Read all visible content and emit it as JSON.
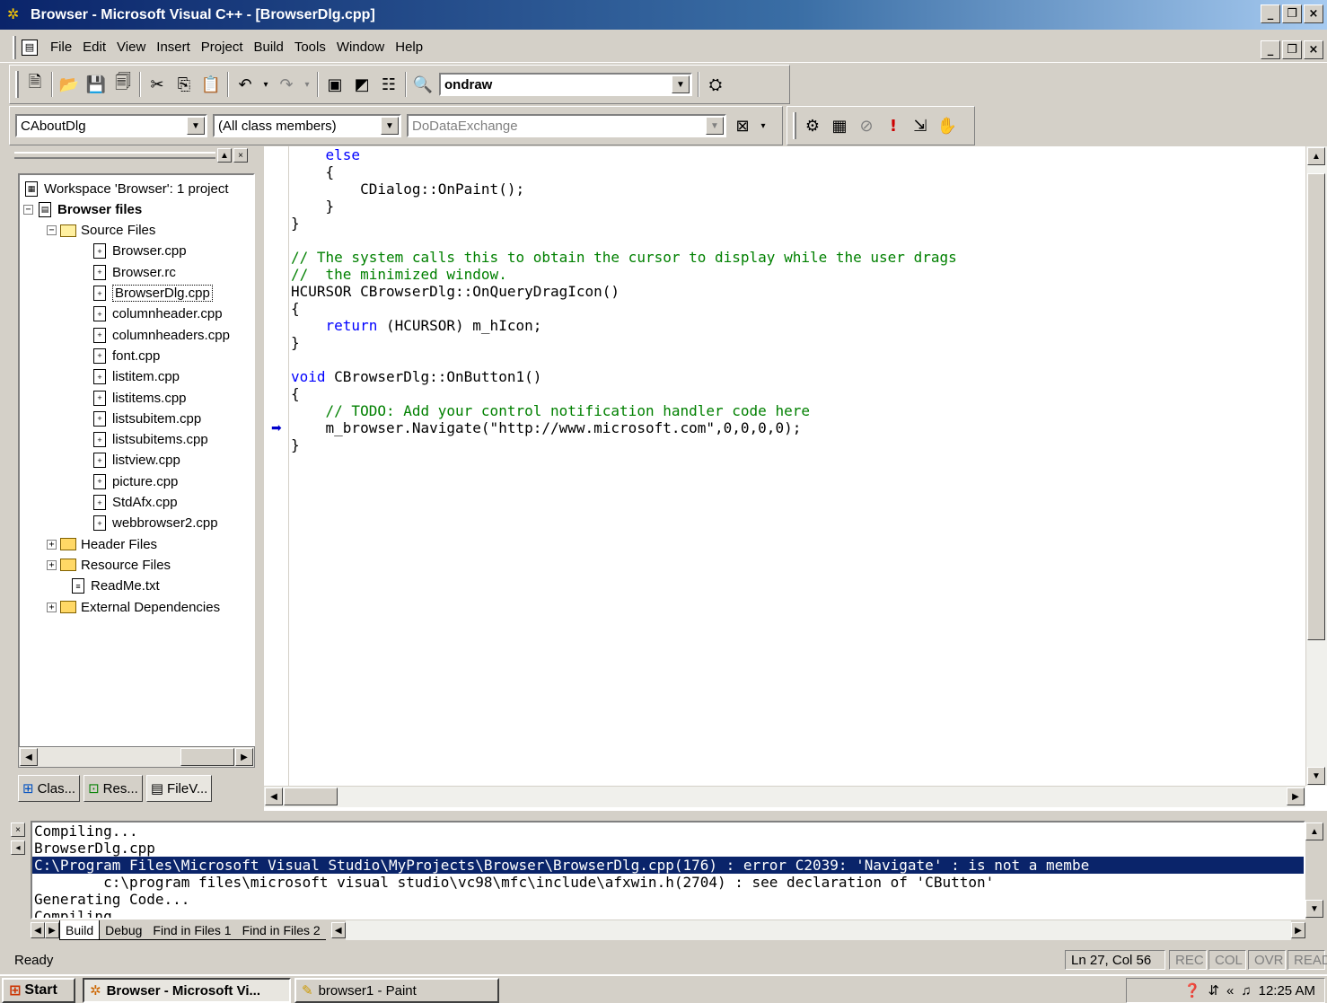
{
  "window": {
    "title": "Browser - Microsoft Visual C++ - [BrowserDlg.cpp]",
    "min": "_",
    "restore": "❐",
    "close": "×"
  },
  "menu": {
    "items": [
      "File",
      "Edit",
      "View",
      "Insert",
      "Project",
      "Build",
      "Tools",
      "Window",
      "Help"
    ]
  },
  "toolbar": {
    "find_combo_value": "ondraw"
  },
  "wizardbar": {
    "class_combo": "CAboutDlg",
    "filter_combo": "(All class members)",
    "member_combo": "DoDataExchange"
  },
  "workspace": {
    "root": "Workspace 'Browser': 1 project",
    "project": "Browser files",
    "source_folder": "Source Files",
    "source_files": [
      "Browser.cpp",
      "Browser.rc",
      "BrowserDlg.cpp",
      "columnheader.cpp",
      "columnheaders.cpp",
      "font.cpp",
      "listitem.cpp",
      "listitems.cpp",
      "listsubitem.cpp",
      "listsubitems.cpp",
      "listview.cpp",
      "picture.cpp",
      "StdAfx.cpp",
      "webbrowser2.cpp"
    ],
    "header_folder": "Header Files",
    "resource_folder": "Resource Files",
    "readme": "ReadMe.txt",
    "external": "External Dependencies",
    "tabs": [
      "Clas...",
      "Res...",
      "FileV..."
    ]
  },
  "editor": {
    "lines": [
      {
        "indent": "    ",
        "parts": [
          {
            "t": "kw",
            "s": "else"
          }
        ]
      },
      {
        "indent": "    ",
        "parts": [
          {
            "t": "",
            "s": "{"
          }
        ]
      },
      {
        "indent": "        ",
        "parts": [
          {
            "t": "",
            "s": "CDialog::OnPaint();"
          }
        ]
      },
      {
        "indent": "    ",
        "parts": [
          {
            "t": "",
            "s": "}"
          }
        ]
      },
      {
        "indent": "",
        "parts": [
          {
            "t": "",
            "s": "}"
          }
        ]
      },
      {
        "indent": "",
        "parts": [
          {
            "t": "",
            "s": ""
          }
        ]
      },
      {
        "indent": "",
        "parts": [
          {
            "t": "cm",
            "s": "// The system calls this to obtain the cursor to display while the user drags"
          }
        ]
      },
      {
        "indent": "",
        "parts": [
          {
            "t": "cm",
            "s": "//  the minimized window."
          }
        ]
      },
      {
        "indent": "",
        "parts": [
          {
            "t": "",
            "s": "HCURSOR CBrowserDlg::OnQueryDragIcon()"
          }
        ]
      },
      {
        "indent": "",
        "parts": [
          {
            "t": "",
            "s": "{"
          }
        ]
      },
      {
        "indent": "    ",
        "parts": [
          {
            "t": "kw",
            "s": "return"
          },
          {
            "t": "",
            "s": " (HCURSOR) m_hIcon;"
          }
        ]
      },
      {
        "indent": "",
        "parts": [
          {
            "t": "",
            "s": "}"
          }
        ]
      },
      {
        "indent": "",
        "parts": [
          {
            "t": "",
            "s": ""
          }
        ]
      },
      {
        "indent": "",
        "parts": [
          {
            "t": "kw",
            "s": "void"
          },
          {
            "t": "",
            "s": " CBrowserDlg::OnButton1()"
          }
        ]
      },
      {
        "indent": "",
        "parts": [
          {
            "t": "",
            "s": "{"
          }
        ]
      },
      {
        "indent": "    ",
        "parts": [
          {
            "t": "cm",
            "s": "// TODO: Add your control notification handler code here"
          }
        ]
      },
      {
        "indent": "    ",
        "parts": [
          {
            "t": "",
            "s": "m_browser.Navigate(\"http://www.microsoft.com\",0,0,0,0);"
          }
        ]
      },
      {
        "indent": "",
        "parts": [
          {
            "t": "",
            "s": "}"
          }
        ]
      }
    ]
  },
  "output": {
    "lines": [
      "Compiling...",
      "BrowserDlg.cpp",
      "C:\\Program Files\\Microsoft Visual Studio\\MyProjects\\Browser\\BrowserDlg.cpp(176) : error C2039: 'Navigate' : is not a membe",
      "        c:\\program files\\microsoft visual studio\\vc98\\mfc\\include\\afxwin.h(2704) : see declaration of 'CButton'",
      "Generating Code...",
      "Compiling..."
    ],
    "highlight_index": 2,
    "tabs": [
      "Build",
      "Debug",
      "Find in Files 1",
      "Find in Files 2"
    ]
  },
  "status": {
    "text": "Ready",
    "position": "Ln 27, Col 56",
    "rec": "REC",
    "col": "COL",
    "ovr": "OVR",
    "read": "READ"
  },
  "taskbar": {
    "start": "Start",
    "task1": "Browser - Microsoft Vi...",
    "task2": "browser1 - Paint",
    "time": "12:25 AM"
  }
}
